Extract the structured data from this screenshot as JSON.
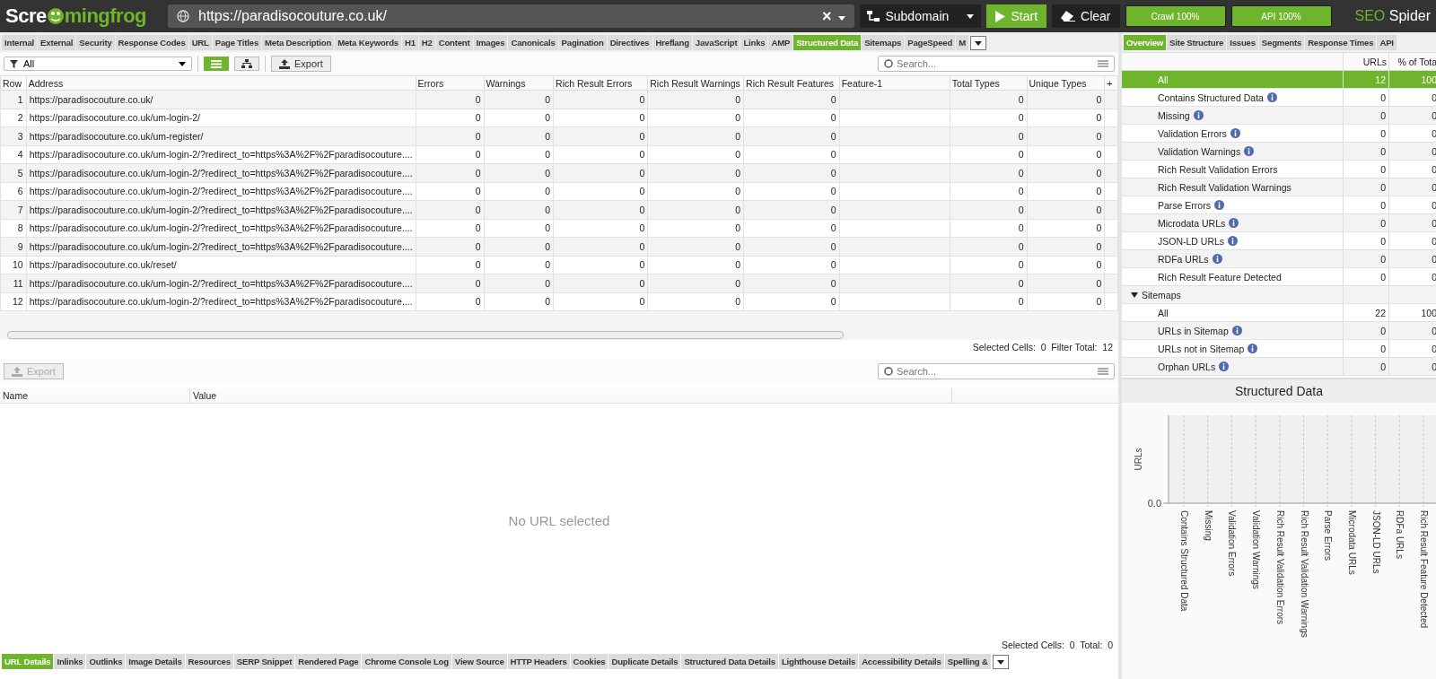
{
  "toolbar": {
    "logo_start": "Scre",
    "logo_end": "mingfrog",
    "url": "https://paradisocouture.co.uk/",
    "clear_glyph": "×",
    "mode": "Subdomain",
    "start": "Start",
    "clear": "Clear",
    "progress": [
      {
        "label": "Crawl 100%",
        "level": 1
      },
      {
        "label": "API 100%",
        "level": 1
      }
    ],
    "brand_left": "SEO",
    "brand_right": "Spider"
  },
  "tabs": [
    {
      "label": "Internal",
      "selected": false
    },
    {
      "label": "External",
      "selected": false
    },
    {
      "label": "Security",
      "selected": false
    },
    {
      "label": "Response Codes",
      "selected": false
    },
    {
      "label": "URL",
      "selected": false
    },
    {
      "label": "Page Titles",
      "selected": false
    },
    {
      "label": "Meta Description",
      "selected": false
    },
    {
      "label": "Meta Keywords",
      "selected": false
    },
    {
      "label": "H1",
      "selected": false
    },
    {
      "label": "H2",
      "selected": false
    },
    {
      "label": "Content",
      "selected": false
    },
    {
      "label": "Images",
      "selected": false
    },
    {
      "label": "Canonicals",
      "selected": false
    },
    {
      "label": "Pagination",
      "selected": false
    },
    {
      "label": "Directives",
      "selected": false
    },
    {
      "label": "Hreflang",
      "selected": false
    },
    {
      "label": "JavaScript",
      "selected": false
    },
    {
      "label": "Links",
      "selected": false
    },
    {
      "label": "AMP",
      "selected": false
    },
    {
      "label": "Structured Data",
      "selected": true
    },
    {
      "label": "Sitemaps",
      "selected": false
    },
    {
      "label": "PageSpeed",
      "selected": false
    },
    {
      "label": "M",
      "selected": false
    }
  ],
  "filter": {
    "value": "All",
    "views": [
      {
        "kind": "list",
        "selected": true
      },
      {
        "kind": "tree",
        "selected": false
      }
    ],
    "export": "Export",
    "search_placeholder": "Search..."
  },
  "table": {
    "columns": [
      "Row",
      "Address",
      "Errors",
      "Warnings",
      "Rich Result Errors",
      "Rich Result Warnings",
      "Rich Result Features",
      "Feature-1",
      "Total Types",
      "Unique Types"
    ],
    "add_column": "+",
    "rows": [
      [
        "1",
        "https://paradisocouture.co.uk/",
        "0",
        "0",
        "0",
        "0",
        "0",
        "",
        "0",
        "0"
      ],
      [
        "2",
        "https://paradisocouture.co.uk/um-login-2/",
        "0",
        "0",
        "0",
        "0",
        "0",
        "",
        "0",
        "0"
      ],
      [
        "3",
        "https://paradisocouture.co.uk/um-register/",
        "0",
        "0",
        "0",
        "0",
        "0",
        "",
        "0",
        "0"
      ],
      [
        "4",
        "https://paradisocouture.co.uk/um-login-2/?redirect_to=https%3A%2F%2Fparadisocouture....",
        "0",
        "0",
        "0",
        "0",
        "0",
        "",
        "0",
        "0"
      ],
      [
        "5",
        "https://paradisocouture.co.uk/um-login-2/?redirect_to=https%3A%2F%2Fparadisocouture....",
        "0",
        "0",
        "0",
        "0",
        "0",
        "",
        "0",
        "0"
      ],
      [
        "6",
        "https://paradisocouture.co.uk/um-login-2/?redirect_to=https%3A%2F%2Fparadisocouture....",
        "0",
        "0",
        "0",
        "0",
        "0",
        "",
        "0",
        "0"
      ],
      [
        "7",
        "https://paradisocouture.co.uk/um-login-2/?redirect_to=https%3A%2F%2Fparadisocouture....",
        "0",
        "0",
        "0",
        "0",
        "0",
        "",
        "0",
        "0"
      ],
      [
        "8",
        "https://paradisocouture.co.uk/um-login-2/?redirect_to=https%3A%2F%2Fparadisocouture....",
        "0",
        "0",
        "0",
        "0",
        "0",
        "",
        "0",
        "0"
      ],
      [
        "9",
        "https://paradisocouture.co.uk/um-login-2/?redirect_to=https%3A%2F%2Fparadisocouture....",
        "0",
        "0",
        "0",
        "0",
        "0",
        "",
        "0",
        "0"
      ],
      [
        "10",
        "https://paradisocouture.co.uk/reset/",
        "0",
        "0",
        "0",
        "0",
        "0",
        "",
        "0",
        "0"
      ],
      [
        "11",
        "https://paradisocouture.co.uk/um-login-2/?redirect_to=https%3A%2F%2Fparadisocouture....",
        "0",
        "0",
        "0",
        "0",
        "0",
        "",
        "0",
        "0"
      ],
      [
        "12",
        "https://paradisocouture.co.uk/um-login-2/?redirect_to=https%3A%2F%2Fparadisocouture....",
        "0",
        "0",
        "0",
        "0",
        "0",
        "",
        "0",
        "0"
      ]
    ],
    "status": "Selected Cells:  0  Filter Total:  12"
  },
  "details": {
    "export": "Export",
    "export_disabled": true,
    "search_placeholder": "Search...",
    "columns": [
      "Name",
      "Value"
    ],
    "empty": "No URL selected",
    "status": "Selected Cells:  0  Total:  0"
  },
  "bottom_tabs": [
    {
      "label": "URL Details",
      "selected": true
    },
    {
      "label": "Inlinks",
      "selected": false
    },
    {
      "label": "Outlinks",
      "selected": false
    },
    {
      "label": "Image Details",
      "selected": false
    },
    {
      "label": "Resources",
      "selected": false
    },
    {
      "label": "SERP Snippet",
      "selected": false
    },
    {
      "label": "Rendered Page",
      "selected": false
    },
    {
      "label": "Chrome Console Log",
      "selected": false
    },
    {
      "label": "View Source",
      "selected": false
    },
    {
      "label": "HTTP Headers",
      "selected": false
    },
    {
      "label": "Cookies",
      "selected": false
    },
    {
      "label": "Duplicate Details",
      "selected": false
    },
    {
      "label": "Structured Data Details",
      "selected": false
    },
    {
      "label": "Lighthouse Details",
      "selected": false
    },
    {
      "label": "Accessibility Details",
      "selected": false
    },
    {
      "label": "Spelling &",
      "selected": false
    }
  ],
  "side_tabs": [
    {
      "label": "Overview",
      "selected": true
    },
    {
      "label": "Site Structure",
      "selected": false
    },
    {
      "label": "Issues",
      "selected": false
    },
    {
      "label": "Segments",
      "selected": false
    },
    {
      "label": "Response Times",
      "selected": false
    },
    {
      "label": "API",
      "selected": false
    }
  ],
  "overview": {
    "columns": [
      "URLs",
      "% of Tota"
    ],
    "rows": [
      {
        "label": "All",
        "urls": "12",
        "percent": "100",
        "info": false,
        "selected": true
      },
      {
        "label": "Contains Structured Data",
        "urls": "0",
        "percent": "0",
        "info": true,
        "selected": false
      },
      {
        "label": "Missing",
        "urls": "0",
        "percent": "0",
        "info": true,
        "selected": false
      },
      {
        "label": "Validation Errors",
        "urls": "0",
        "percent": "0",
        "info": true,
        "selected": false
      },
      {
        "label": "Validation Warnings",
        "urls": "0",
        "percent": "0",
        "info": true,
        "selected": false
      },
      {
        "label": "Rich Result Validation Errors",
        "urls": "0",
        "percent": "0",
        "info": false,
        "selected": false
      },
      {
        "label": "Rich Result Validation Warnings",
        "urls": "0",
        "percent": "0",
        "info": false,
        "selected": false
      },
      {
        "label": "Parse Errors",
        "urls": "0",
        "percent": "0",
        "info": true,
        "selected": false
      },
      {
        "label": "Microdata URLs",
        "urls": "0",
        "percent": "0",
        "info": true,
        "selected": false
      },
      {
        "label": "JSON-LD URLs",
        "urls": "0",
        "percent": "0",
        "info": true,
        "selected": false
      },
      {
        "label": "RDFa URLs",
        "urls": "0",
        "percent": "0",
        "info": true,
        "selected": false
      },
      {
        "label": "Rich Result Feature Detected",
        "urls": "0",
        "percent": "0",
        "info": false,
        "selected": false
      }
    ],
    "groups": [
      {
        "label": "Sitemaps",
        "expanded": true,
        "children": [
          {
            "label": "All",
            "urls": "22",
            "percent": "100",
            "info": false,
            "selected": false
          },
          {
            "label": "URLs in Sitemap",
            "urls": "0",
            "percent": "0",
            "info": true,
            "selected": false
          },
          {
            "label": "URLs not in Sitemap",
            "urls": "0",
            "percent": "0",
            "info": true,
            "selected": false
          },
          {
            "label": "Orphan URLs",
            "urls": "0",
            "percent": "0",
            "info": true,
            "selected": false
          }
        ]
      }
    ]
  },
  "chart": {
    "title": "Structured Data",
    "ylabel": "URLs",
    "categories": [
      "Contains Structured Data",
      "Missing",
      "Validation Errors",
      "Validation Warnings",
      "Rich Result Validation Errors",
      "Rich Result Validation Warnings",
      "Parse Errors",
      "Microdata URLs",
      "JSON-LD URLs",
      "RDFa URLs",
      "Rich Result Feature Detected"
    ],
    "y_tick_label": "0.0"
  }
}
